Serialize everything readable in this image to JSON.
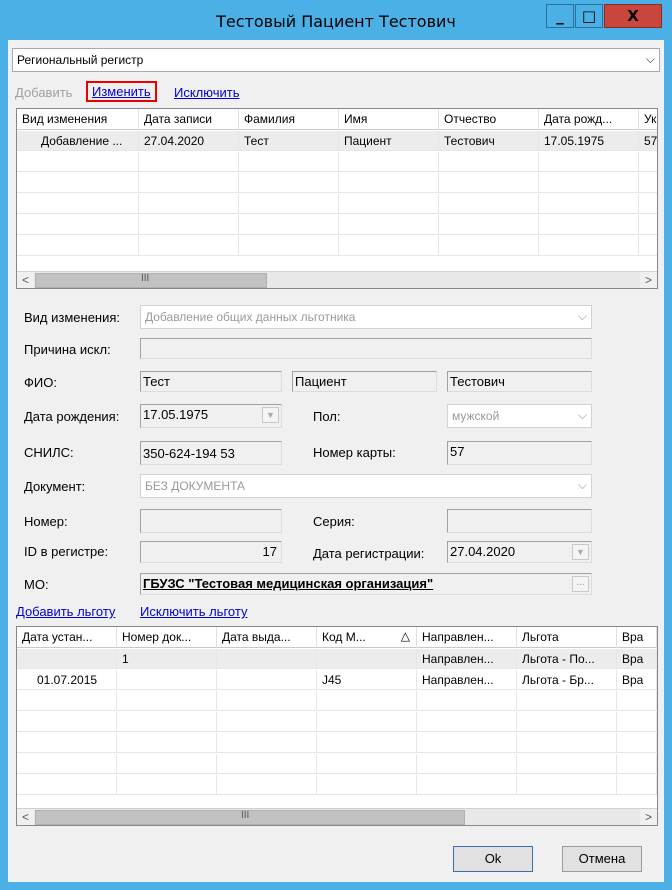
{
  "window": {
    "title": "Тестовый Пациент Тестович"
  },
  "titlebar": {
    "minimize": "_",
    "maximize": "□",
    "close": "X"
  },
  "register_select": {
    "value": "Региональный регистр"
  },
  "actions": {
    "add": "Добавить",
    "edit": "Изменить",
    "exclude": "Исключить"
  },
  "changes_table": {
    "columns": [
      "Вид изменения",
      "Дата записи",
      "Фамилия",
      "Имя",
      "Отчество",
      "Дата рожд...",
      "Ук"
    ],
    "rows": [
      [
        "Добавление ...",
        "27.04.2020",
        "Тест",
        "Пациент",
        "Тестович",
        "17.05.1975",
        "57"
      ]
    ],
    "scroll_grip": "III"
  },
  "form": {
    "change_type_label": "Вид изменения:",
    "change_type_value": "Добавление общих данных льготника",
    "exclusion_reason_label": "Причина искл:",
    "exclusion_reason_value": "",
    "fio_label": "ФИО:",
    "last_name": "Тест",
    "first_name": "Пациент",
    "middle_name": "Тестович",
    "birth_date_label": "Дата рождения:",
    "birth_date": "17.05.1975",
    "sex_label": "Пол:",
    "sex_value": "мужской",
    "snils_label": "СНИЛС:",
    "snils_value": "350-624-194 53",
    "card_number_label": "Номер карты:",
    "card_number_value": "57",
    "document_label": "Документ:",
    "document_value": "БЕЗ ДОКУМЕНТА",
    "number_label": "Номер:",
    "number_value": "",
    "series_label": "Серия:",
    "series_value": "",
    "register_id_label": "ID в регистре:",
    "register_id_value": "17",
    "reg_date_label": "Дата регистрации:",
    "reg_date_value": "27.04.2020",
    "mo_label": "МО:",
    "mo_value": "ГБУЗС \"Тестовая медицинская организация\"",
    "mo_browse": "..."
  },
  "benefit_actions": {
    "add": "Добавить льготу",
    "exclude": "Исключить льготу"
  },
  "benefits_table": {
    "columns": [
      "Дата устан...",
      "Номер док...",
      "Дата выда...",
      "Код М...",
      "Направлен...",
      "Льгота",
      "Вра"
    ],
    "sort_indicator": "△",
    "rows": [
      [
        "",
        "1",
        "",
        "",
        "Направлен...",
        "Льгота - По...",
        "Вра"
      ],
      [
        "01.07.2015",
        "",
        "",
        "J45",
        "Направлен...",
        "Льгота - Бр...",
        "Вра"
      ]
    ],
    "scroll_grip": "III"
  },
  "buttons": {
    "ok": "Ok",
    "cancel": "Отмена"
  }
}
